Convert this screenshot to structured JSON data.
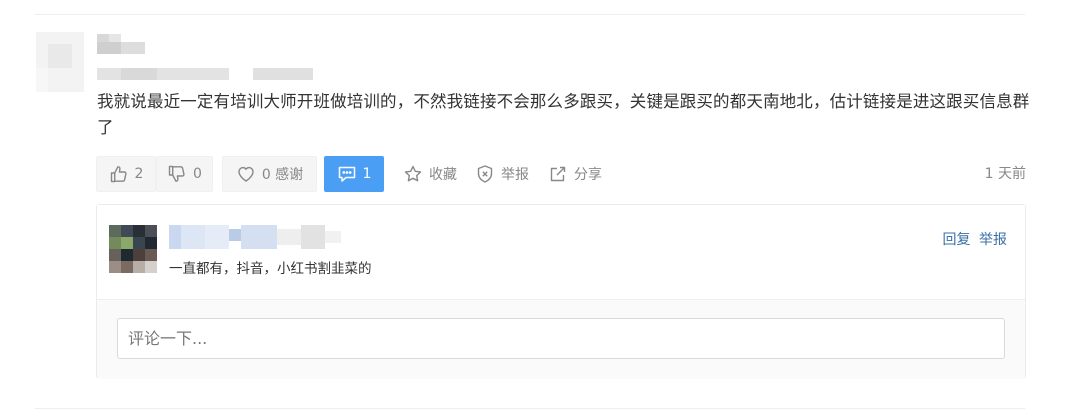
{
  "comment": {
    "text": "我就说最近一定有培训大师开班做培训的，不然我链接不会那么多跟买，关键是跟买的都天南地北，估计链接是进这跟买信息群了"
  },
  "actions": {
    "like_count": "2",
    "dislike_count": "0",
    "thanks_label": "0 感谢",
    "reply_count": "1",
    "collect_label": "收藏",
    "report_label": "举报",
    "share_label": "分享",
    "time": "1 天前"
  },
  "reply": {
    "text": "一直都有，抖音，小红书割韭菜的",
    "reply_link": "回复",
    "report_link": "举报"
  },
  "comment_box": {
    "placeholder": "评论一下..."
  },
  "colors": {
    "accent": "#4a9ff5",
    "link": "#3a6fa6",
    "muted": "#888888"
  }
}
